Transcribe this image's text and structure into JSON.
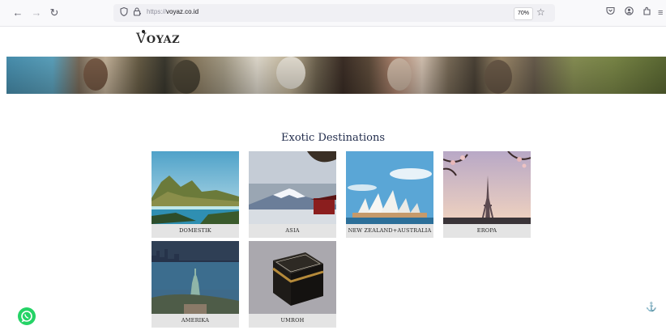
{
  "browser": {
    "url_protocol": "https://",
    "url_host": "voyaz.co.id",
    "zoom": "70%"
  },
  "site": {
    "logo_initial": "V",
    "logo_rest": "OYAZ",
    "section_title": "Exotic Destinations"
  },
  "destinations": [
    {
      "label": "DOMESTIK"
    },
    {
      "label": "ASIA"
    },
    {
      "label": "NEW ZEALAND+AUSTRALIA"
    },
    {
      "label": "EROPA"
    },
    {
      "label": "AMERIKA"
    },
    {
      "label": "UMROH"
    }
  ],
  "icons": {
    "back": "back-arrow-icon",
    "forward": "forward-arrow-icon",
    "reload": "reload-icon",
    "shield": "tracking-shield-icon",
    "lock": "lock-icon",
    "bookmark": "bookmark-star-icon",
    "pocket": "pocket-icon",
    "account": "account-icon",
    "extensions": "extensions-icon",
    "menu": "hamburger-menu-icon",
    "whatsapp": "whatsapp-icon",
    "scroll_top": "anchor-icon"
  },
  "colors": {
    "whatsapp": "#25d366",
    "title": "#1f2a4a",
    "label_bg": "#e4e4e4"
  }
}
